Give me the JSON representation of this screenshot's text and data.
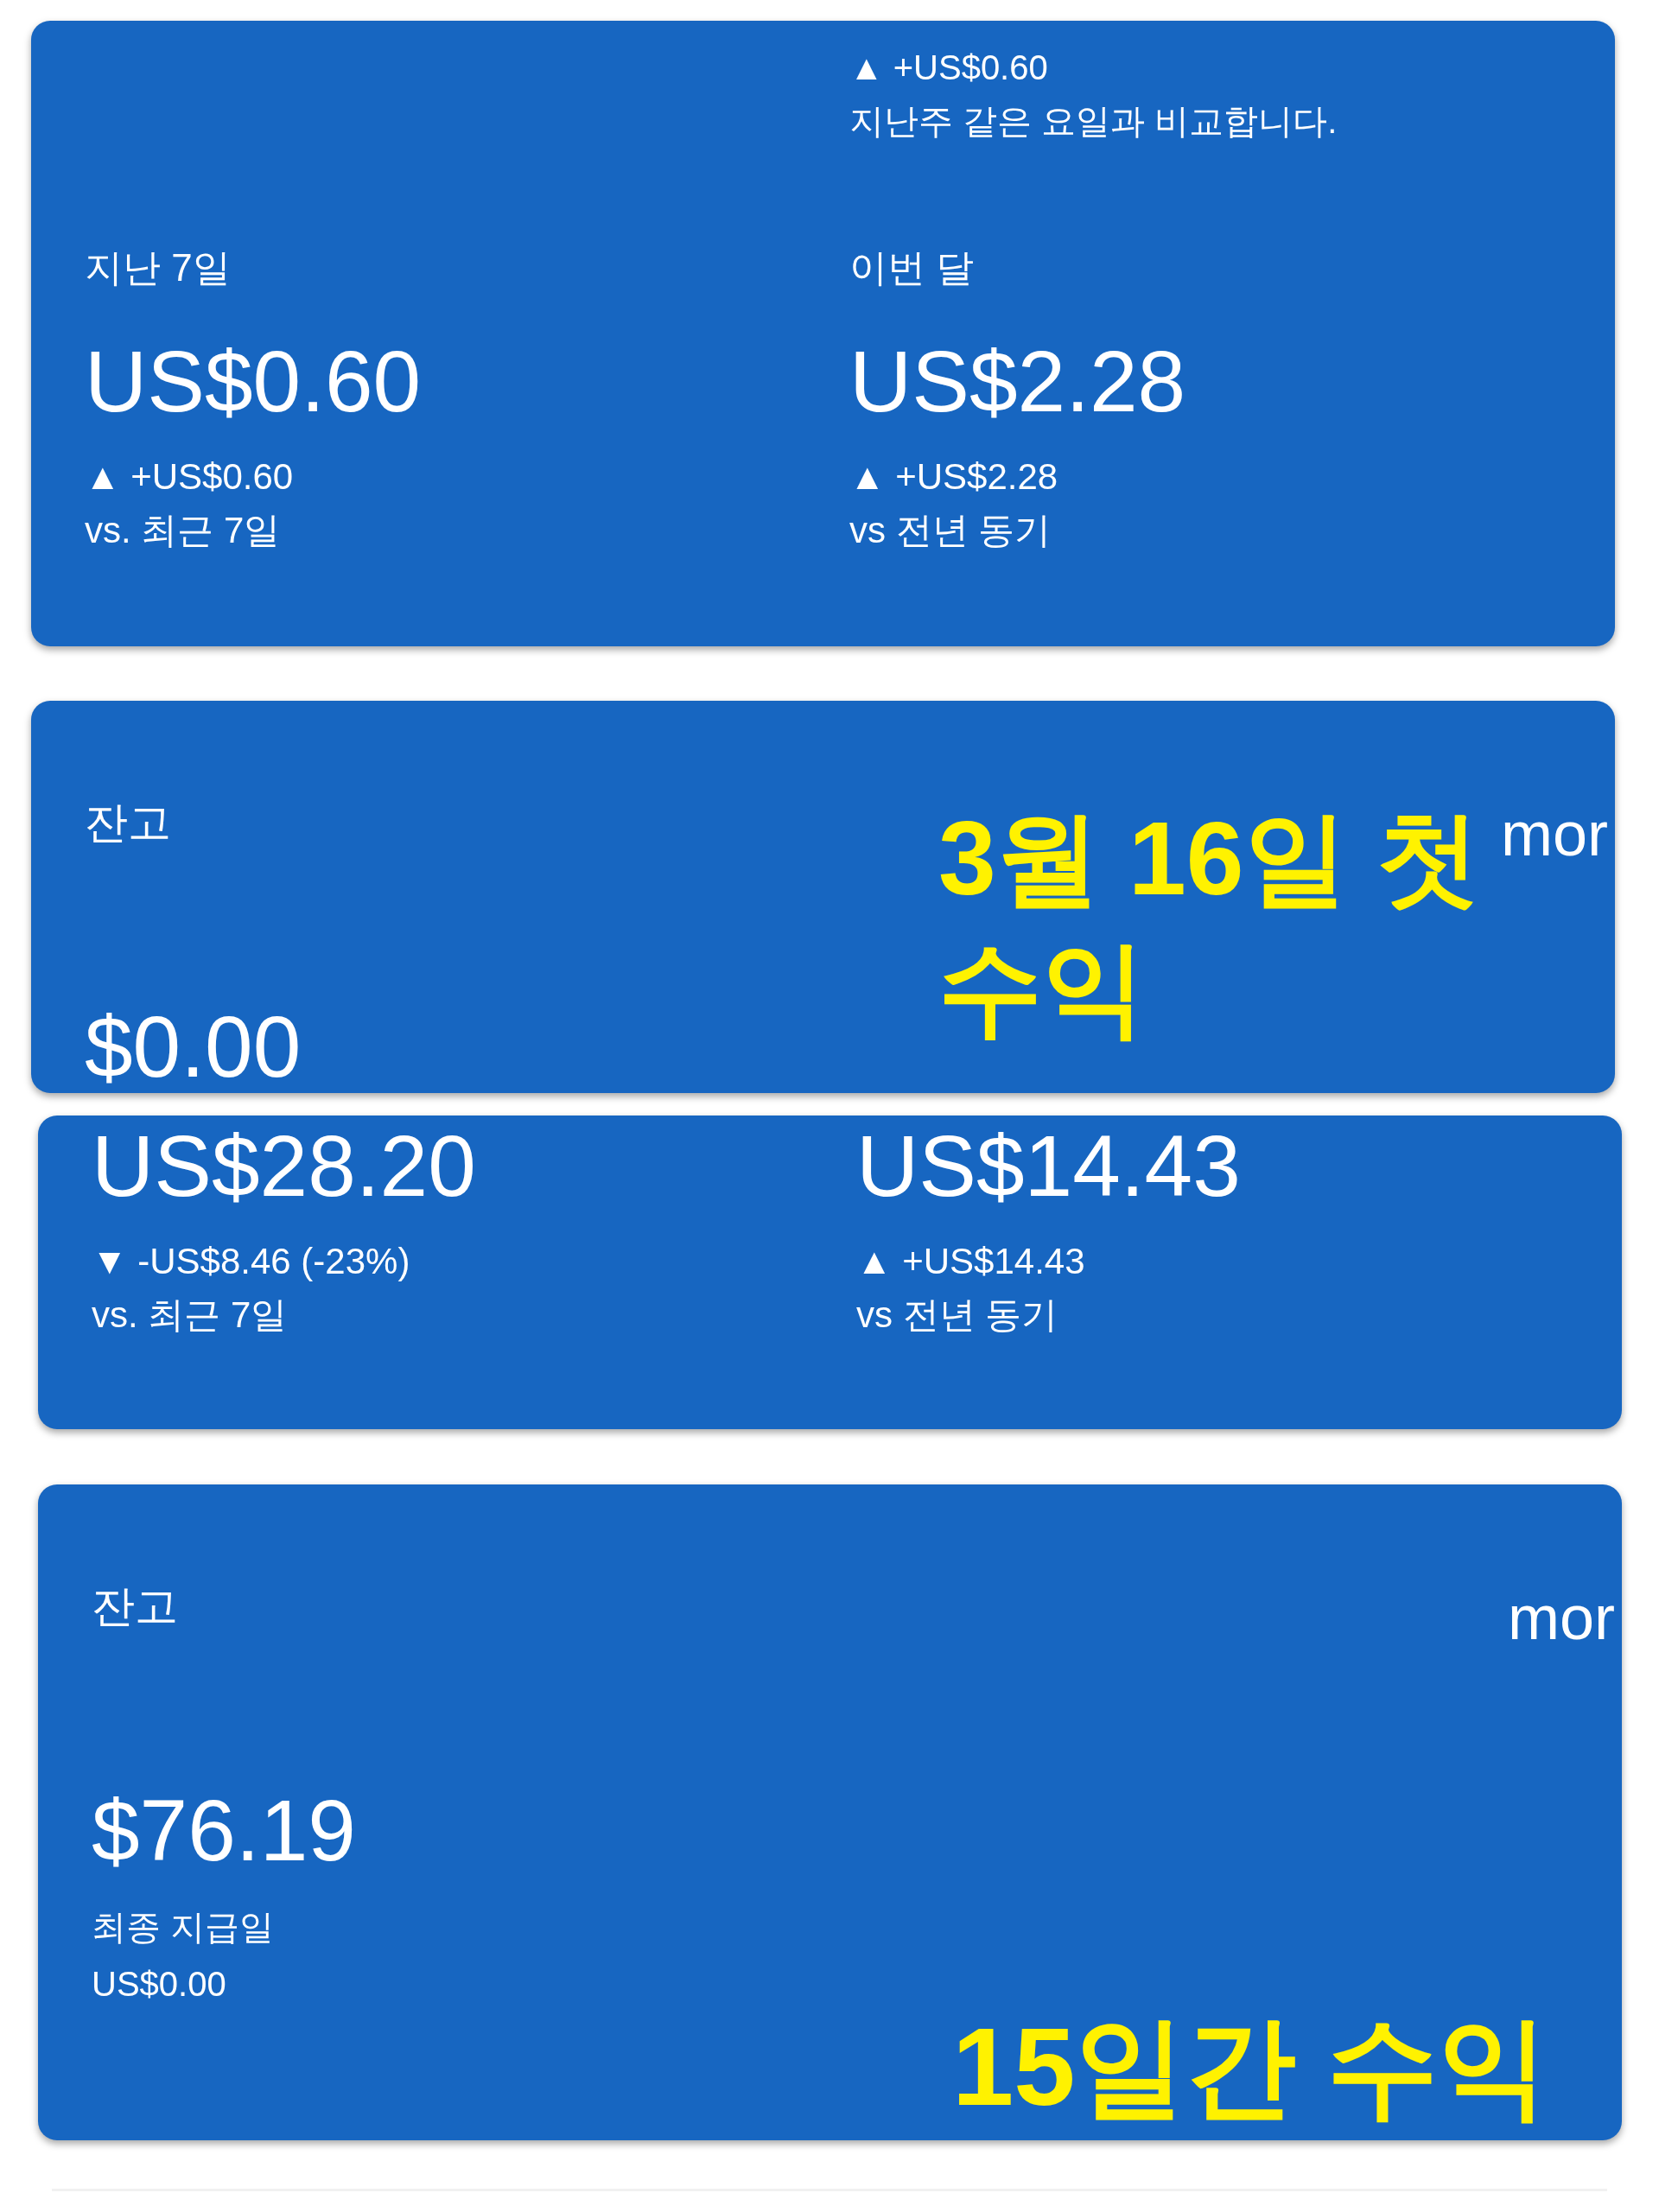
{
  "cards": [
    {
      "kind": "stats",
      "partial_top": {
        "change": "▲ +US$0.60",
        "note": "지난주 같은 요일과 비교합니다."
      },
      "columns": [
        {
          "label": "지난 7일",
          "amount": "US$0.60",
          "change": "▲ +US$0.60",
          "comparison": "vs. 최근 7일"
        },
        {
          "label": "이번 달",
          "amount": "US$2.28",
          "change": "▲ +US$2.28",
          "comparison": "vs 전년 동기"
        }
      ]
    },
    {
      "kind": "balance",
      "label": "잔고",
      "link": "mor",
      "amount": "$0.00",
      "annotation": "3월 16일 첫 수익"
    },
    {
      "kind": "stats",
      "columns": [
        {
          "amount": "US$28.20",
          "change": "▼ -US$8.46 (-23%)",
          "comparison": "vs. 최근 7일"
        },
        {
          "amount": "US$14.43",
          "change": "▲ +US$14.43",
          "comparison": "vs 전년 동기"
        }
      ]
    },
    {
      "kind": "balance",
      "label": "잔고",
      "link": "mor",
      "amount": "$76.19",
      "payout_label": "최종 지급일",
      "payout_amount": "US$0.00",
      "annotation": "15일간 수익"
    }
  ]
}
